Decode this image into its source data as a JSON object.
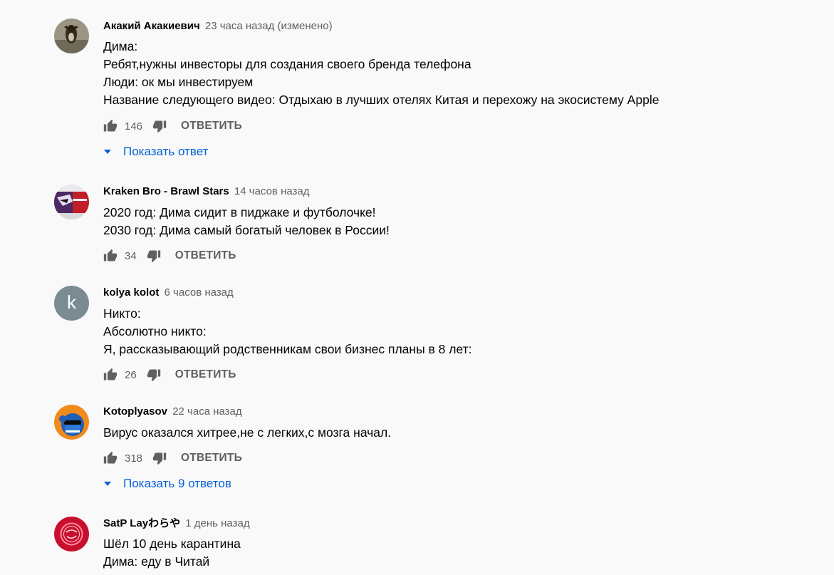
{
  "comments": [
    {
      "author": "Акакий Акакиевич",
      "time": "23 часа назад (изменено)",
      "avatar_icon": "bird-avatar",
      "lines": [
        "Дима:",
        "Ребят,нужны инвесторы для создания своего бренда телефона",
        "Люди: ок мы инвестируем",
        "Название следующего видео: Отдыхаю в лучших отелях Китая и перехожу на экосистему Apple"
      ],
      "likes": "146",
      "reply_label": "ОТВЕТИТЬ",
      "replies_label": "Показать ответ"
    },
    {
      "author": "Kraken Bro - Brawl Stars",
      "time": "14 часов назад",
      "avatar_icon": "character-avatar",
      "lines": [
        "2020 год: Дима сидит в пиджаке и футболочке!",
        "2030 год: Дима самый богатый человек в России!"
      ],
      "likes": "34",
      "reply_label": "ОТВЕТИТЬ"
    },
    {
      "author": "kolya kolot",
      "time": "6 часов назад",
      "avatar_icon": "letter-avatar",
      "avatar_letter": "k",
      "lines": [
        "Никто:",
        "Абсолютно никто:",
        "Я, рассказывающий родственникам свои бизнес планы в 8 лет:"
      ],
      "likes": "26",
      "reply_label": "ОТВЕТИТЬ"
    },
    {
      "author": "Kotoplyasov",
      "time": "22 часа назад",
      "avatar_icon": "monkey-avatar",
      "lines": [
        "Вирус оказался хитрее,не с легких,с мозга начал."
      ],
      "likes": "318",
      "reply_label": "ОТВЕТИТЬ",
      "replies_label": "Показать 9 ответов"
    },
    {
      "author": "SatP Layわらや",
      "time": "1 день назад",
      "avatar_icon": "neon-logo-avatar",
      "lines": [
        "Шёл 10 день карантина",
        "Дима: еду в Читай"
      ]
    }
  ],
  "colors": {
    "link": "#065fd4",
    "secondary_text": "#606060",
    "primary_text": "#030303",
    "letter_avatar_bg": "#7b8b93"
  }
}
